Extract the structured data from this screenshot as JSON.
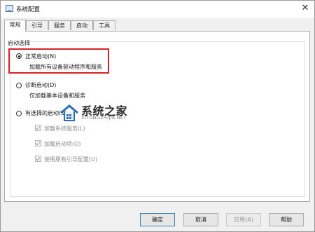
{
  "window": {
    "title": "系统配置",
    "close_glyph": "✕"
  },
  "tabs": [
    {
      "label": "常规",
      "active": true
    },
    {
      "label": "引导",
      "active": false
    },
    {
      "label": "服务",
      "active": false
    },
    {
      "label": "启动",
      "active": false
    },
    {
      "label": "工具",
      "active": false
    }
  ],
  "startup": {
    "group_title": "启动选择",
    "options": [
      {
        "label": "正常启动(N)",
        "description": "加载所有设备驱动程序和服务",
        "selected": true
      },
      {
        "label": "诊断启动(D)",
        "description": "仅加载基本设备和服务",
        "selected": false
      },
      {
        "label": "有选择的启动(S)",
        "selected": false
      }
    ],
    "selective_items": [
      {
        "label": "加载系统服务(L)",
        "checked": true,
        "enabled": false
      },
      {
        "label": "加载启动项(O)",
        "checked": true,
        "enabled": false
      },
      {
        "label": "使用原有引导配置(U)",
        "checked": true,
        "enabled": false
      }
    ]
  },
  "watermark": {
    "title": "系统之家",
    "subtitle": "XITONGZHIJIA.NET"
  },
  "buttons": {
    "ok": "确定",
    "cancel": "取消",
    "apply": "应用(A)",
    "help": "帮助"
  },
  "colors": {
    "highlight": "#d9232a"
  }
}
